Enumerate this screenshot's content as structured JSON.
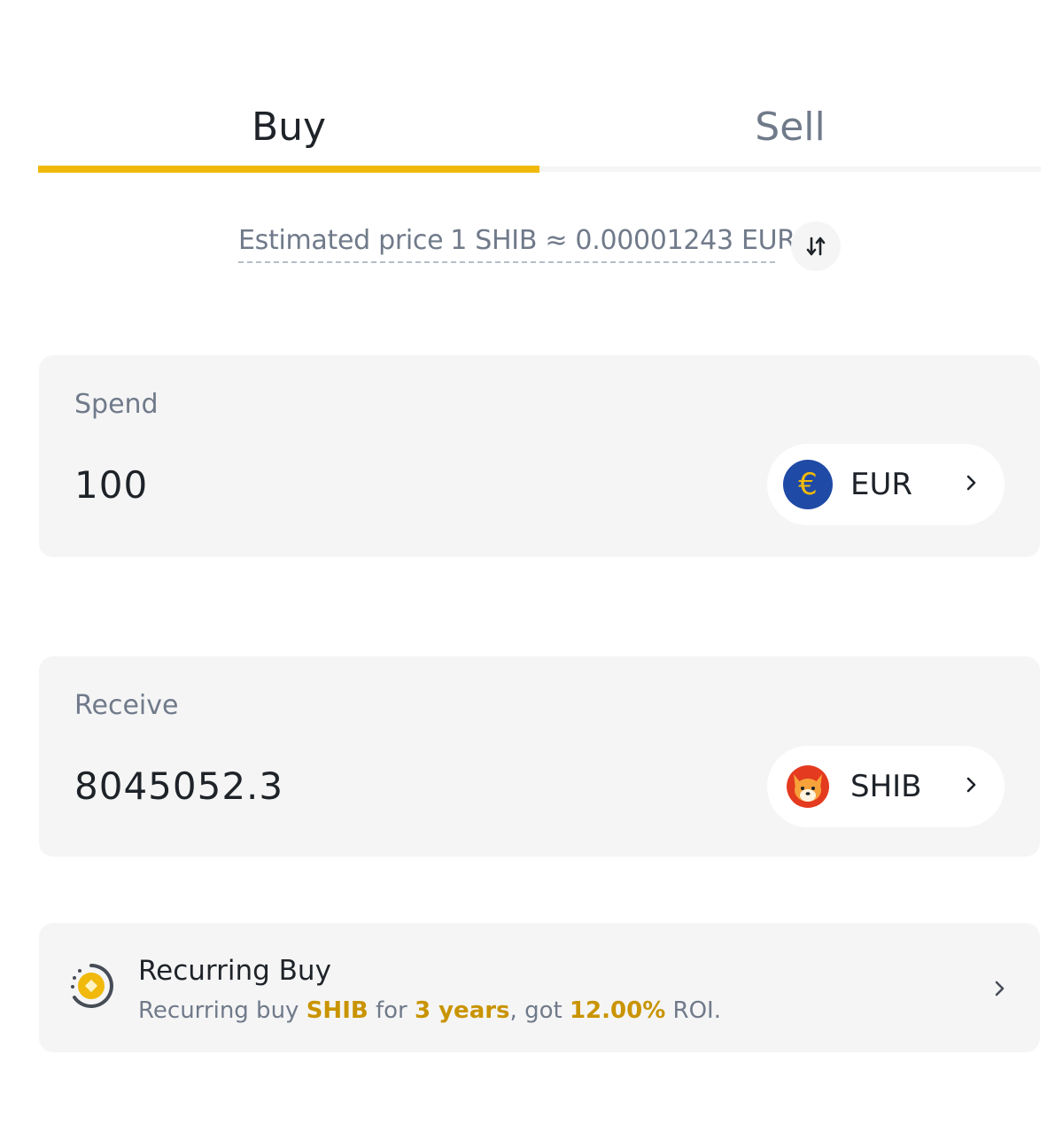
{
  "tabs": {
    "buy_label": "Buy",
    "sell_label": "Sell",
    "active": "Buy"
  },
  "price": {
    "label": "Estimated price",
    "value": "1 SHIB ≈ 0.00001243 EUR"
  },
  "spend": {
    "label": "Spend",
    "amount": "100",
    "currency": "EUR",
    "currency_icon": "euro-coin-icon",
    "currency_symbol": "€"
  },
  "receive": {
    "label": "Receive",
    "amount": "8045052.3",
    "currency": "SHIB",
    "currency_icon": "shiba-inu-coin-icon"
  },
  "recurring": {
    "title": "Recurring Buy",
    "desc_prefix": "Recurring buy ",
    "desc_coin": "SHIB",
    "desc_for": " for ",
    "desc_duration": "3 years",
    "desc_got": ", got ",
    "desc_roi": "12.00%",
    "desc_suffix": " ROI."
  },
  "colors": {
    "accent": "#f0b90b",
    "highlight_text": "#c99400",
    "muted_text": "#707a8a",
    "card_bg": "#f5f5f5",
    "eur_blue": "#1f4aa6"
  }
}
